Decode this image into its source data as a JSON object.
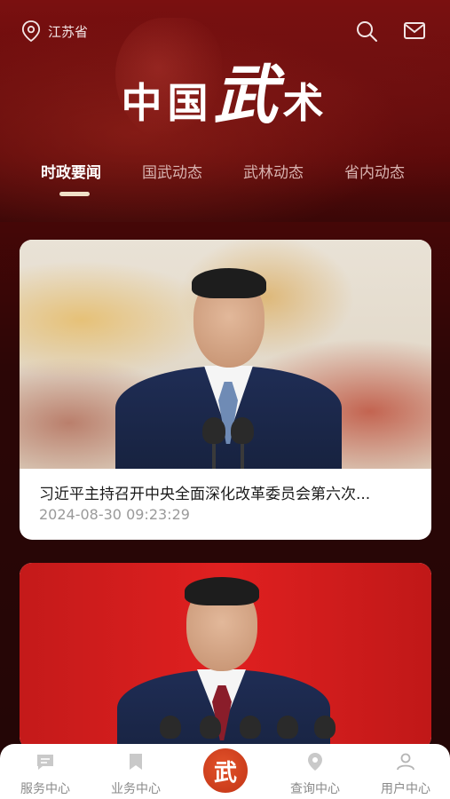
{
  "header": {
    "location": "江苏省",
    "brand_part1": "中国",
    "brand_part2": "武",
    "brand_part3": "术"
  },
  "tabs": [
    {
      "label": "时政要闻",
      "active": true
    },
    {
      "label": "国武动态",
      "active": false
    },
    {
      "label": "武林动态",
      "active": false
    },
    {
      "label": "省内动态",
      "active": false
    }
  ],
  "news": [
    {
      "title": "习近平主持召开中央全面深化改革委员会第六次...",
      "date": "2024-08-30 09:23:29"
    },
    {
      "title": "",
      "date": ""
    }
  ],
  "bottom_nav": {
    "items": [
      {
        "label": "服务中心",
        "icon": "chat-icon"
      },
      {
        "label": "业务中心",
        "icon": "bookmark-icon"
      },
      {
        "label": "查询中心",
        "icon": "location-pin-icon"
      },
      {
        "label": "用户中心",
        "icon": "user-icon"
      }
    ],
    "center_label": "武"
  },
  "colors": {
    "primary_red": "#6b0e0e",
    "accent_orange": "#d9441f",
    "nav_text": "#8a8a8a"
  }
}
